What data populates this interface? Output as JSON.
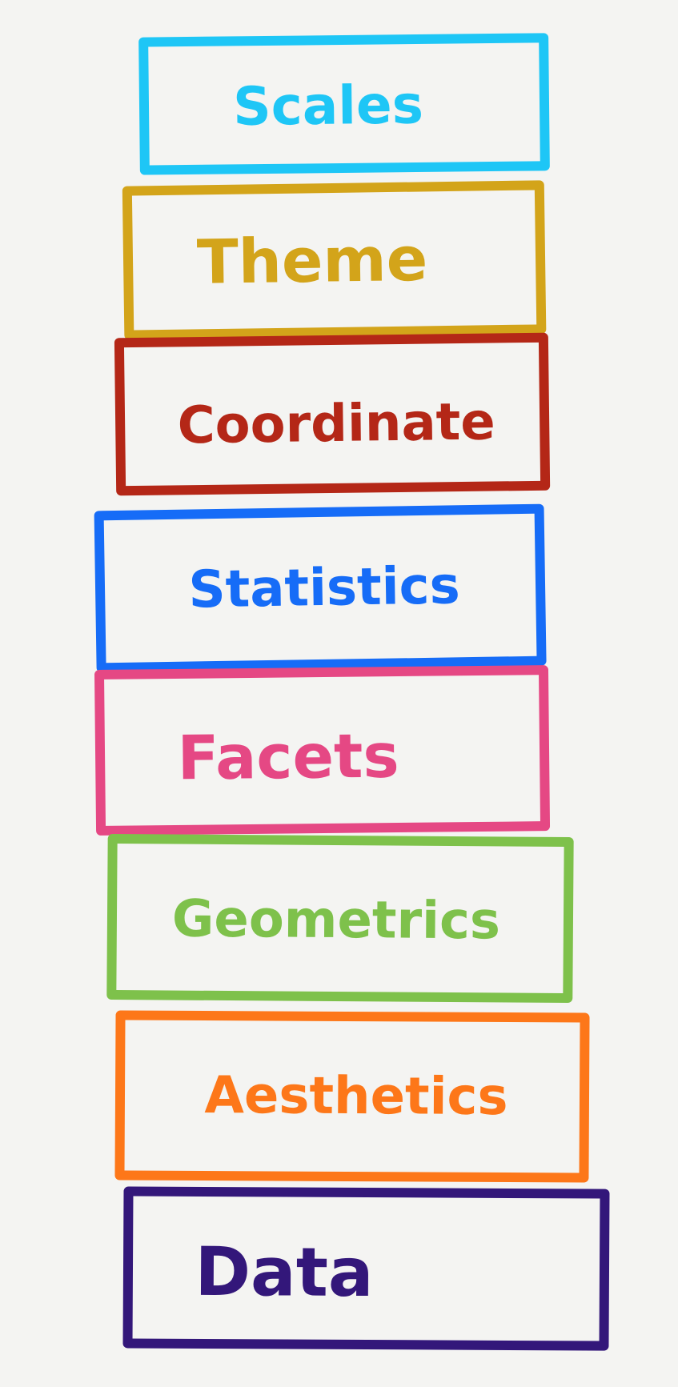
{
  "diagram": {
    "layers": [
      {
        "label": "Scales",
        "color": "#1ec6f6"
      },
      {
        "label": "Theme",
        "color": "#d3a41a"
      },
      {
        "label": "Coordinate",
        "color": "#b42717"
      },
      {
        "label": "Statistics",
        "color": "#166cf7"
      },
      {
        "label": "Facets",
        "color": "#e54884"
      },
      {
        "label": "Geometrics",
        "color": "#7ec14b"
      },
      {
        "label": "Aesthetics",
        "color": "#fd7719"
      },
      {
        "label": "Data",
        "color": "#33177a"
      }
    ]
  }
}
